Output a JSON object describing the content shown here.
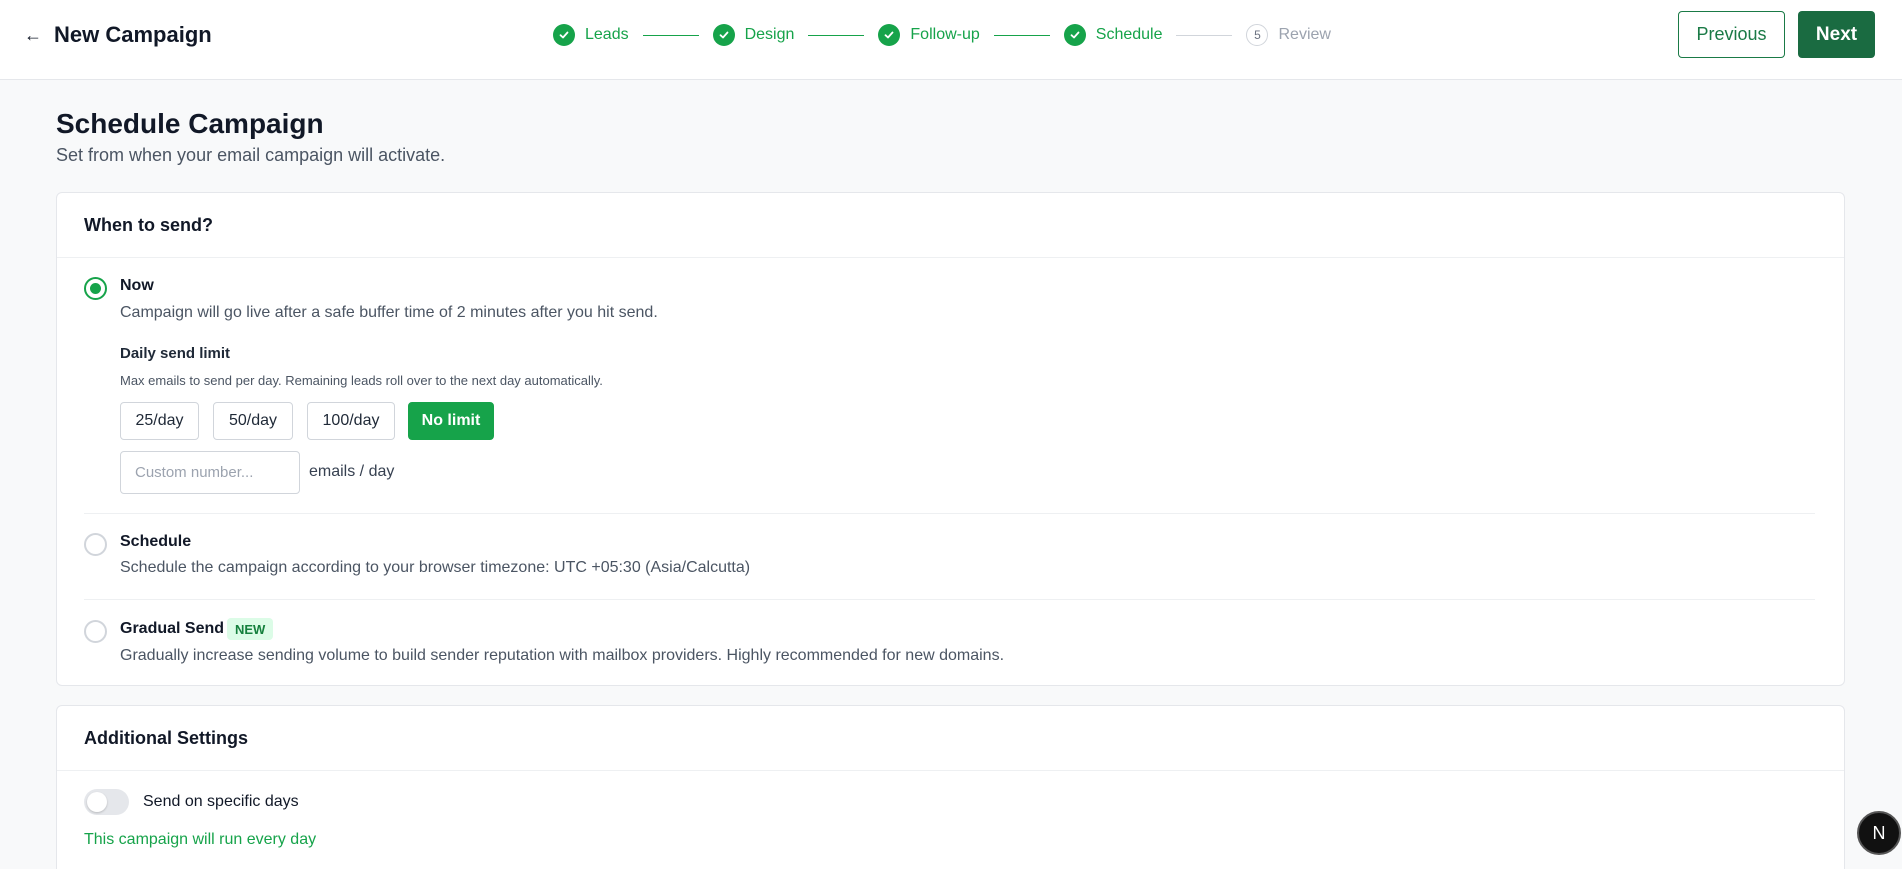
{
  "header": {
    "back_icon": "arrow-left-icon",
    "title": "New Campaign",
    "previous_label": "Previous",
    "next_label": "Next"
  },
  "stepper": {
    "accent": "#16a34a",
    "steps": [
      {
        "label": "Leads",
        "status": "done",
        "icon": "check-icon"
      },
      {
        "label": "Design",
        "status": "done",
        "icon": "check-icon"
      },
      {
        "label": "Follow-up",
        "status": "done",
        "icon": "check-icon"
      },
      {
        "label": "Schedule",
        "status": "done",
        "icon": "check-icon"
      },
      {
        "label": "Review",
        "status": "pending",
        "number": "5"
      }
    ]
  },
  "page": {
    "title": "Schedule Campaign",
    "subtitle": "Set from when your email campaign will activate."
  },
  "when_to_send": {
    "heading": "When to send?",
    "options": [
      {
        "title": "Now",
        "description": "Campaign will go live after a safe buffer time of 2 minutes after you hit send.",
        "selected": true
      },
      {
        "title": "Schedule",
        "description": "Schedule the campaign according to your browser timezone: UTC +05:30 (Asia/Calcutta)",
        "selected": false
      },
      {
        "title": "Gradual Send",
        "badge": "NEW",
        "description": "Gradually increase sending volume to build sender reputation with mailbox providers. Highly recommended for new domains.",
        "selected": false
      }
    ],
    "daily_limit": {
      "title": "Daily send limit",
      "description": "Max emails to send per day. Remaining leads roll over to the next day automatically.",
      "chips": [
        "25/day",
        "50/day",
        "100/day",
        "No limit"
      ],
      "selected_chip": "No limit",
      "custom_placeholder": "Custom number...",
      "custom_value": "",
      "unit_label": "emails / day"
    }
  },
  "additional_settings": {
    "heading": "Additional Settings",
    "specific_days_label": "Send on specific days",
    "specific_days_enabled": false,
    "run_note": "This campaign will run every day"
  },
  "fab": {
    "label": "N"
  }
}
